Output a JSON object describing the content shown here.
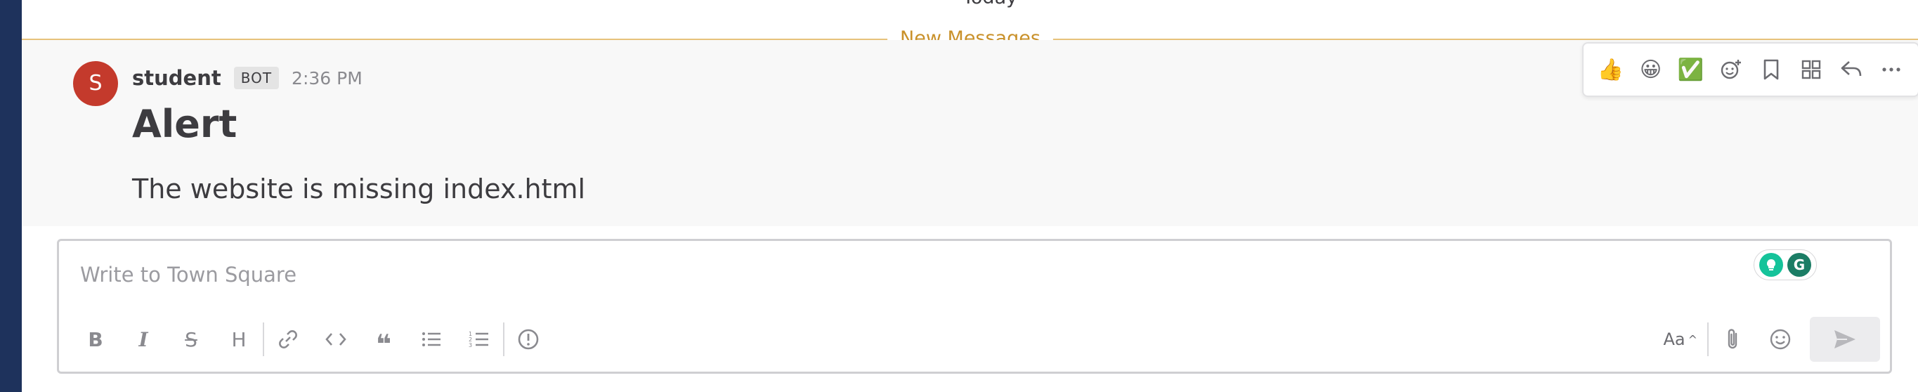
{
  "date_separator": "Today",
  "new_messages_label": "New Messages",
  "message": {
    "avatar_initial": "S",
    "username": "student",
    "bot_badge": "BOT",
    "time": "2:36 PM",
    "title": "Alert",
    "body": "The website is missing index.html"
  },
  "actions": {
    "items": [
      "thumbs-up-icon",
      "grinning-face-icon",
      "check-mark-icon",
      "add-reaction-icon",
      "bookmark-icon",
      "apps-icon",
      "reply-icon",
      "more-icon"
    ]
  },
  "composer": {
    "placeholder": "Write to Town Square",
    "value": "",
    "format_toggle_label": "Aa"
  },
  "colors": {
    "sidebar": "#1e325c",
    "avatar": "#c43a2c",
    "new_messages": "#c9912a",
    "grammarly_green": "#15c39a"
  }
}
